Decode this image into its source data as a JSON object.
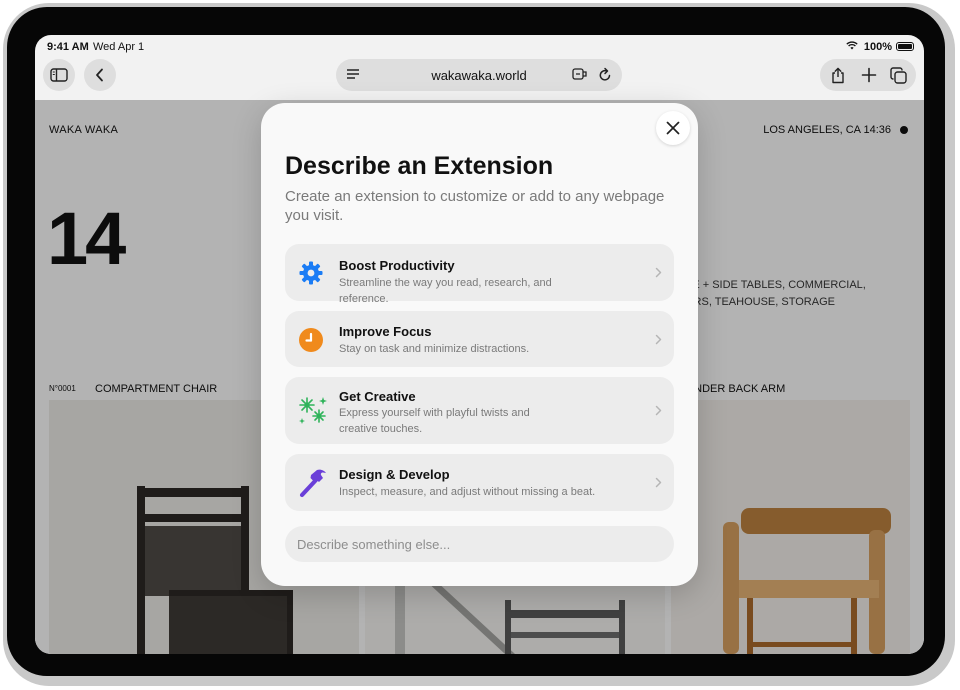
{
  "status": {
    "time": "9:41 AM",
    "date": "Wed Apr 1",
    "battery": "100%"
  },
  "browser": {
    "url": "wakawaka.world"
  },
  "website": {
    "brand": "WAKA WAKA",
    "location": "LOS ANGELES, CA 14:36",
    "big_number": "14",
    "categories_line1": "EE + SIDE TABLES,  COMMERCIAL,",
    "categories_line2": "ORS,  TEAHOUSE,  STORAGE",
    "product1_number": "N°0001",
    "product1_name": "COMPARTMENT CHAIR",
    "product3_name": "LINDER BACK ARM"
  },
  "sheet": {
    "title": "Describe an Extension",
    "subtitle": "Create an extension to customize or add to any webpage you visit.",
    "options": [
      {
        "title": "Boost Productivity",
        "description": "Streamline the way you read, research, and reference.",
        "icon": "gear-icon",
        "color": "#1a7cf5"
      },
      {
        "title": "Improve Focus",
        "description": "Stay on task and minimize distractions.",
        "icon": "clock-icon",
        "color": "#f08a1c"
      },
      {
        "title": "Get Creative",
        "description": "Express yourself with playful twists and creative touches.",
        "icon": "sparkles-icon",
        "color": "#2fb35a"
      },
      {
        "title": "Design & Develop",
        "description": "Inspect, measure, and adjust without missing a beat.",
        "icon": "hammer-icon",
        "color": "#6a3fd8"
      }
    ],
    "input_placeholder": "Describe something else..."
  }
}
